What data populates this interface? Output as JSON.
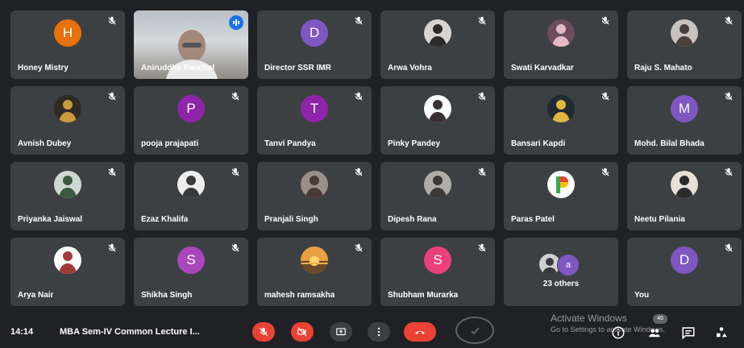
{
  "tiles": [
    {
      "name": "Honey Mistry",
      "initial": "H",
      "avatar_color": "#e8710a",
      "kind": "initial"
    },
    {
      "name": "Aniruddha Panchal",
      "kind": "video",
      "speaking": true
    },
    {
      "name": "Director SSR IMR",
      "initial": "D",
      "avatar_color": "#7e57c2",
      "kind": "initial"
    },
    {
      "name": "Arwa Vohra",
      "kind": "photo",
      "photo_bg": "#d9d4cf",
      "photo_fg": "#2b2b2b"
    },
    {
      "name": "Swati Karvadkar",
      "kind": "photo",
      "photo_bg": "#6d4c5b",
      "photo_fg": "#e6b9c6"
    },
    {
      "name": "Raju S. Mahato",
      "kind": "photo",
      "photo_bg": "#c8c3bf",
      "photo_fg": "#4a3f3a"
    },
    {
      "name": "Avnish Dubey",
      "kind": "photo",
      "photo_bg": "#2e2a25",
      "photo_fg": "#c79a3a"
    },
    {
      "name": "pooja prajapati",
      "initial": "P",
      "avatar_color": "#8e24aa",
      "kind": "initial"
    },
    {
      "name": "Tanvi Pandya",
      "initial": "T",
      "avatar_color": "#8e24aa",
      "kind": "initial"
    },
    {
      "name": "Pinky Pandey",
      "kind": "photo",
      "photo_bg": "#ffffff",
      "photo_fg": "#3a2f33"
    },
    {
      "name": "Bansari Kapdi",
      "kind": "photo",
      "photo_bg": "#1f2a33",
      "photo_fg": "#e0b640"
    },
    {
      "name": "Mohd. Bilal Bhada",
      "initial": "M",
      "avatar_color": "#7e57c2",
      "kind": "initial"
    },
    {
      "name": "Priyanka Jaiswal",
      "kind": "photo",
      "photo_bg": "#cfd8d0",
      "photo_fg": "#3c5a40"
    },
    {
      "name": "Ezaz Khalifa",
      "kind": "photo",
      "photo_bg": "#eeeeee",
      "photo_fg": "#3a3a3a"
    },
    {
      "name": "Pranjali Singh",
      "kind": "photo",
      "photo_bg": "#9b8f8a",
      "photo_fg": "#4a3a36"
    },
    {
      "name": "Dipesh Rana",
      "kind": "photo",
      "photo_bg": "#b0aca6",
      "photo_fg": "#3c3a38"
    },
    {
      "name": "Paras Patel",
      "kind": "logo"
    },
    {
      "name": "Neetu Pilania",
      "kind": "photo",
      "photo_bg": "#e6e0d6",
      "photo_fg": "#2c2c2c"
    },
    {
      "name": "Arya Nair",
      "kind": "photo",
      "photo_bg": "#ffffff",
      "photo_fg": "#a33a3a"
    },
    {
      "name": "Shikha Singh",
      "initial": "S",
      "avatar_color": "#ab47bc",
      "kind": "initial"
    },
    {
      "name": "mahesh ramsakha",
      "kind": "sunset"
    },
    {
      "name": "Shubham Murarka",
      "initial": "S",
      "avatar_color": "#ec407a",
      "kind": "initial"
    },
    {
      "name": "",
      "kind": "others",
      "others_label": "23 others",
      "others_initial": "a"
    },
    {
      "name": "You",
      "initial": "D",
      "avatar_color": "#7e57c2",
      "kind": "initial"
    }
  ],
  "bottom": {
    "time": "14:14",
    "title": "MBA Sem-IV Common Lecture I...",
    "participants_count": "46"
  },
  "watermark": {
    "line1": "Activate Windows",
    "line2": "Go to Settings to activate Windows."
  },
  "icons": {
    "mic_off": "mic-off-icon",
    "cam_off": "camera-off-icon",
    "present": "present-icon",
    "more": "more-icon",
    "end_call": "end-call-icon",
    "info": "info-icon",
    "people": "people-icon",
    "chat": "chat-icon",
    "activities": "activities-icon"
  },
  "colors": {
    "accent": "#8ab4f8",
    "danger": "#ea4335",
    "tile": "#3c4043",
    "background": "#202124"
  }
}
